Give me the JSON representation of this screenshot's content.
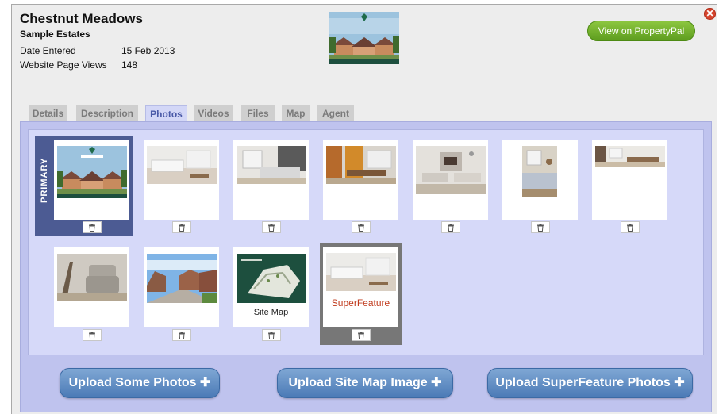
{
  "header": {
    "title": "Chestnut Meadows",
    "agency": "Sample Estates",
    "date_label": "Date Entered",
    "date_value": "15 Feb 2013",
    "views_label": "Website Page Views",
    "views_value": "148",
    "view_button": "View on PropertyPal",
    "close_icon": "close-icon",
    "close_glyph": "✕"
  },
  "tabs": [
    {
      "label": "Details"
    },
    {
      "label": "Description"
    },
    {
      "label": "Photos",
      "active": true
    },
    {
      "label": "Videos"
    },
    {
      "label": "Files"
    },
    {
      "label": "Map"
    },
    {
      "label": "Agent"
    }
  ],
  "photos": {
    "primary_label": "PRIMARY",
    "site_map_caption": "Site Map",
    "superfeature_caption": "SuperFeature",
    "trash_icon": "trash-icon"
  },
  "upload_buttons": {
    "photos": "Upload Some Photos ✚",
    "site_map": "Upload Site Map Image ✚",
    "superfeature": "Upload SuperFeature Photos ✚"
  },
  "colors": {
    "primary_bg": "#4c5b93",
    "active_tab_text": "#4a5aa8",
    "caption_superfeature": "#c0391b",
    "view_button": "#6fae2a"
  }
}
